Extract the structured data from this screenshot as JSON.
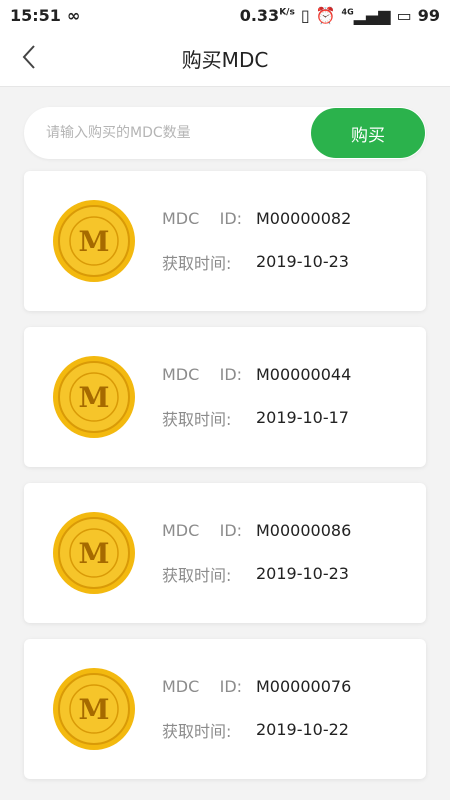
{
  "status": {
    "time": "15:51",
    "speed": "0.33",
    "speed_unit": "K/s",
    "battery": "99",
    "signal_label": "4G"
  },
  "header": {
    "title": "购买MDC"
  },
  "search": {
    "placeholder": "请输入购买的MDC数量",
    "value": "",
    "buy_label": "购买"
  },
  "coin": {
    "letter": "M",
    "colors": {
      "outer": "#f3b90f",
      "inner": "#f6c52a",
      "ring": "#d99a07",
      "text": "#a66a00"
    }
  },
  "items": [
    {
      "id_label": "MDC    ID:",
      "id": "M00000082",
      "time_label": "获取时间:",
      "date": "2019-10-23"
    },
    {
      "id_label": "MDC    ID:",
      "id": "M00000044",
      "time_label": "获取时间:",
      "date": "2019-10-17"
    },
    {
      "id_label": "MDC    ID:",
      "id": "M00000086",
      "time_label": "获取时间:",
      "date": "2019-10-23"
    },
    {
      "id_label": "MDC    ID:",
      "id": "M00000076",
      "time_label": "获取时间:",
      "date": "2019-10-22"
    }
  ]
}
